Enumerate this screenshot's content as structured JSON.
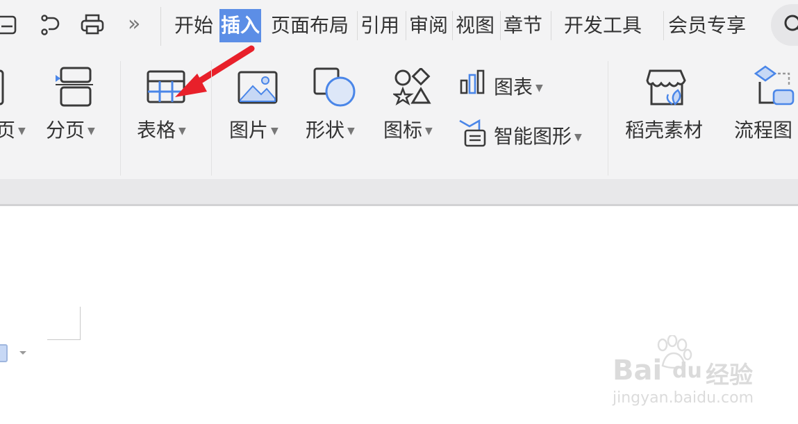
{
  "tabs": [
    {
      "label": "开始",
      "active": false
    },
    {
      "label": "插入",
      "active": true
    },
    {
      "label": "页面布局",
      "active": false
    },
    {
      "label": "引用",
      "active": false
    },
    {
      "label": "审阅",
      "active": false
    },
    {
      "label": "视图",
      "active": false
    },
    {
      "label": "章节",
      "active": false
    },
    {
      "label": "开发工具",
      "active": false
    },
    {
      "label": "会员专享",
      "active": false
    }
  ],
  "quick_access": {
    "more_glyph": "»"
  },
  "ribbon": {
    "blank_page_partial": "页",
    "page_break": "分页",
    "table": "表格",
    "picture": "图片",
    "shape": "形状",
    "icon": "图标",
    "chart": "图表",
    "smart_art": "智能图形",
    "docer_material": "稻壳素材",
    "flowchart": "流程图"
  },
  "colors": {
    "accent": "#5c8ee6",
    "arrow": "#e8202a",
    "icon_stroke": "#3a3a3a",
    "icon_blue": "#4a86e8"
  },
  "watermark": {
    "brand_left": "Bai",
    "brand_right": "du",
    "brand_cn": "经验",
    "url": "jingyan.baidu.com"
  }
}
